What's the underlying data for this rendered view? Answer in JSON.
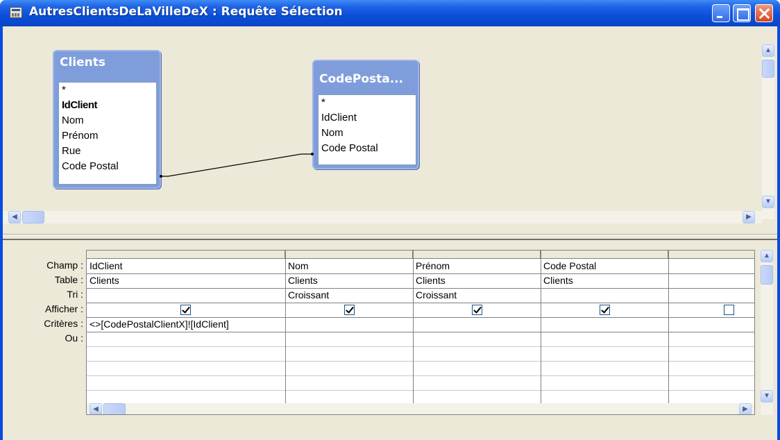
{
  "window": {
    "title": "AutresClientsDeLaVilleDeX : Requête Sélection"
  },
  "tables": [
    {
      "title": "Clients",
      "fields": [
        "*",
        "IdClient",
        "Nom",
        "Prénom",
        "Rue",
        "Code Postal"
      ]
    },
    {
      "title": "CodePosta...",
      "fields": [
        "*",
        "IdClient",
        "Nom",
        "Code Postal"
      ]
    }
  ],
  "grid": {
    "row_labels": [
      "Champ :",
      "Table :",
      "Tri :",
      "Afficher :",
      "Critères :",
      "Ou :"
    ],
    "columns": [
      {
        "champ": "IdClient",
        "table": "Clients",
        "tri": "",
        "afficher": true,
        "criteres": "<>[CodePostalClientX]![IdClient]"
      },
      {
        "champ": "Nom",
        "table": "Clients",
        "tri": "Croissant",
        "afficher": true,
        "criteres": ""
      },
      {
        "champ": "Prénom",
        "table": "Clients",
        "tri": "Croissant",
        "afficher": true,
        "criteres": ""
      },
      {
        "champ": "Code Postal",
        "table": "Clients",
        "tri": "",
        "afficher": true,
        "criteres": ""
      },
      {
        "champ": "",
        "table": "",
        "tri": "",
        "afficher": false,
        "criteres": ""
      }
    ]
  },
  "icons": {
    "scroll_up": "▲",
    "scroll_down": "▼",
    "scroll_left": "◀",
    "scroll_right": "▶"
  }
}
